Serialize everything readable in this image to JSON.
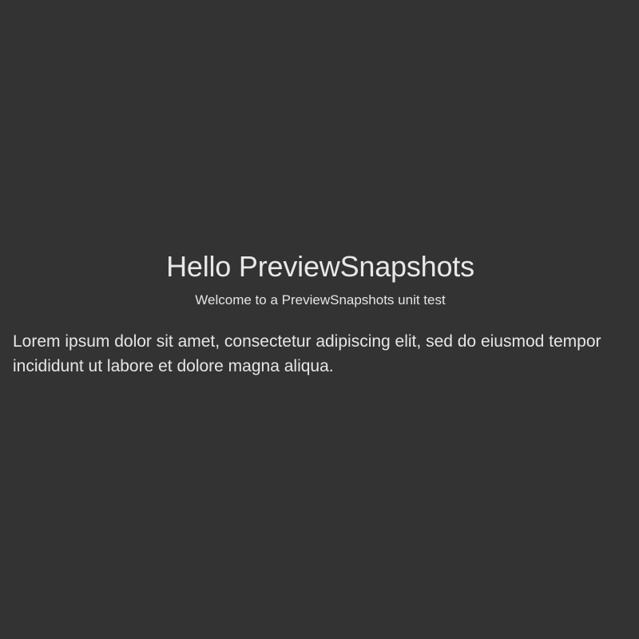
{
  "preview": {
    "title": "Hello PreviewSnapshots",
    "subtitle": "Welcome to a PreviewSnapshots unit test",
    "body": "Lorem ipsum dolor sit amet, consectetur adipiscing elit, sed do eiusmod tempor incididunt ut labore et dolore magna aliqua."
  },
  "colors": {
    "background": "#333333",
    "text": "#e6e6e6"
  }
}
